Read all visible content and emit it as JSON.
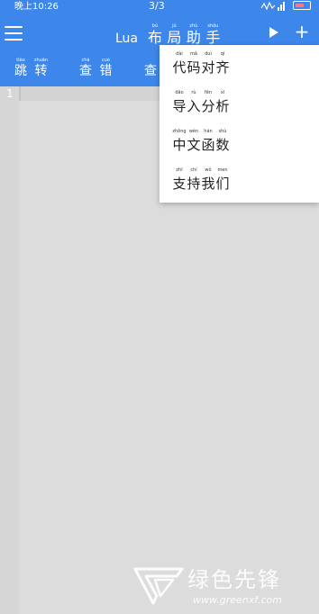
{
  "status_bar": {
    "time": "晚上10:26",
    "page_indicator": "3/3"
  },
  "app_bar": {
    "title_latin": "Lua",
    "title_chars": [
      {
        "char": "布",
        "pinyin": "bù"
      },
      {
        "char": "局",
        "pinyin": "jú"
      },
      {
        "char": "助",
        "pinyin": "zhù"
      },
      {
        "char": "手",
        "pinyin": "shǒu"
      }
    ],
    "icons": [
      "menu-icon",
      "run-icon",
      "add-icon"
    ]
  },
  "toolbar": {
    "buttons": [
      {
        "chars": [
          {
            "char": "跳",
            "pinyin": "tiào"
          },
          {
            "char": "转",
            "pinyin": "zhuǎn"
          }
        ]
      },
      {
        "chars": [
          {
            "char": "查",
            "pinyin": "chá"
          },
          {
            "char": "错",
            "pinyin": "cuò"
          }
        ]
      },
      {
        "chars": [
          {
            "char": "查",
            "pinyin": ""
          }
        ]
      }
    ]
  },
  "editor": {
    "line_numbers": [
      "1"
    ]
  },
  "dropdown_menu": {
    "items": [
      {
        "chars": [
          {
            "char": "代",
            "pinyin": "dài"
          },
          {
            "char": "码",
            "pinyin": "mǎ"
          },
          {
            "char": "对",
            "pinyin": "duì"
          },
          {
            "char": "齐",
            "pinyin": "qí"
          }
        ]
      },
      {
        "chars": [
          {
            "char": "导",
            "pinyin": "dǎo"
          },
          {
            "char": "入",
            "pinyin": "rù"
          },
          {
            "char": "分",
            "pinyin": "fēn"
          },
          {
            "char": "析",
            "pinyin": "xī"
          }
        ]
      },
      {
        "chars": [
          {
            "char": "中",
            "pinyin": "zhōng"
          },
          {
            "char": "文",
            "pinyin": "wén"
          },
          {
            "char": "函",
            "pinyin": "hán"
          },
          {
            "char": "数",
            "pinyin": "shù"
          }
        ]
      },
      {
        "chars": [
          {
            "char": "支",
            "pinyin": "zhī"
          },
          {
            "char": "持",
            "pinyin": "chí"
          },
          {
            "char": "我",
            "pinyin": "wǒ"
          },
          {
            "char": "们",
            "pinyin": "men"
          }
        ]
      }
    ]
  },
  "watermark": {
    "text": "绿色先锋",
    "url": "www.greenxf.com"
  },
  "colors": {
    "primary": "#3d86ea",
    "editor_background": "#dcdcdc",
    "menu_background": "#ffffff"
  }
}
